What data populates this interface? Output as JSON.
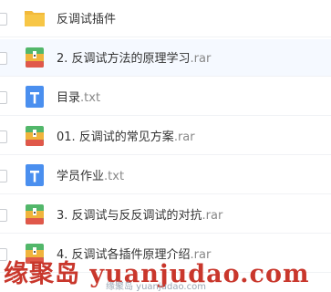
{
  "files": [
    {
      "type": "folder",
      "name": "反调试插件",
      "ext": ""
    },
    {
      "type": "rar",
      "name": "2. 反调试方法的原理学习",
      "ext": ".rar"
    },
    {
      "type": "txt",
      "name": "目录",
      "ext": ".txt"
    },
    {
      "type": "rar",
      "name": "01. 反调试的常见方案",
      "ext": ".rar"
    },
    {
      "type": "txt",
      "name": "学员作业",
      "ext": ".txt"
    },
    {
      "type": "rar",
      "name": "3. 反调试与反反调试的对抗",
      "ext": ".rar"
    },
    {
      "type": "rar",
      "name": "4. 反调试各插件原理介绍",
      "ext": ".rar"
    }
  ],
  "watermark": {
    "big": "缘聚岛 yuanjudao.com",
    "small": "缘聚岛 yuanjudao.com"
  },
  "colors": {
    "folder": "#f7c646",
    "txt": "#4a8fef",
    "rar_top": "#52b76a",
    "rar_mid": "#f0b43c",
    "rar_bottom": "#e0584a",
    "watermark": "#c9372c"
  }
}
